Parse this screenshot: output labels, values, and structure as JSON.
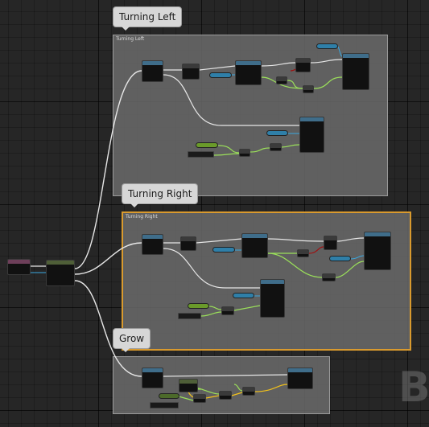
{
  "comments": {
    "turning_left": {
      "bubble": "Turning Left",
      "title": "Turning Left"
    },
    "turning_right": {
      "bubble": "Turning Right",
      "title": "Turning Right"
    },
    "grow": {
      "bubble": "Grow",
      "title": ""
    }
  },
  "watermark": "B",
  "colors": {
    "exec_wire": "#e8e8e8",
    "float_wire": "#9be05a",
    "vector_wire": "#f2c11a",
    "object_wire": "#3aa8e0",
    "bool_wire": "#a01010",
    "selection": "#d99a2e"
  }
}
